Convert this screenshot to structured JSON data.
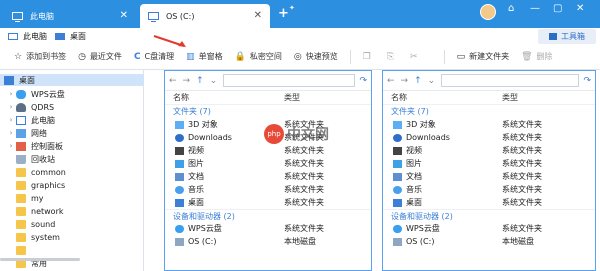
{
  "tabs": [
    {
      "label": "此电脑",
      "active": false
    },
    {
      "label": "OS (C:)",
      "active": true
    }
  ],
  "window_controls": {
    "minimize": "—",
    "restore": "▢",
    "close": "✕"
  },
  "quick_access": [
    {
      "label": "此电脑",
      "icon": "pc-icon"
    },
    {
      "label": "桌面",
      "icon": "desktop-icon"
    }
  ],
  "toolbox_label": "工具箱",
  "commands": [
    {
      "label": "添加到书签",
      "icon": "☆"
    },
    {
      "label": "最近文件",
      "icon": "◷"
    },
    {
      "label": "C盘清理",
      "icon": "C"
    },
    {
      "label": "单窗格",
      "icon": "▥"
    },
    {
      "label": "私密空间",
      "icon": "🔒"
    },
    {
      "label": "快速预览",
      "icon": "◎"
    }
  ],
  "edit_tools": {
    "copy": "❐",
    "paste": "⎘",
    "cut": "✂"
  },
  "right_commands": [
    {
      "label": "新建文件夹",
      "icon": "▭"
    },
    {
      "label": "删除",
      "icon": "🗑"
    }
  ],
  "sidebar": [
    {
      "label": "桌面",
      "icon": "desktop",
      "chev": "",
      "selected": true,
      "level": 0
    },
    {
      "label": "WPS云盘",
      "icon": "cloud",
      "chev": "›",
      "level": 1
    },
    {
      "label": "QDRS",
      "icon": "person",
      "chev": "›",
      "level": 1
    },
    {
      "label": "此电脑",
      "icon": "pc",
      "chev": "›",
      "level": 1
    },
    {
      "label": "网络",
      "icon": "net",
      "chev": "›",
      "level": 1
    },
    {
      "label": "控制面板",
      "icon": "ctrl",
      "chev": "›",
      "level": 1
    },
    {
      "label": "回收站",
      "icon": "bin",
      "chev": "",
      "level": 1
    },
    {
      "label": "common",
      "icon": "folder",
      "chev": "",
      "level": 1
    },
    {
      "label": "graphics",
      "icon": "folder",
      "chev": "",
      "level": 1
    },
    {
      "label": "my",
      "icon": "folder",
      "chev": "",
      "level": 1
    },
    {
      "label": "network",
      "icon": "folder",
      "chev": "",
      "level": 1
    },
    {
      "label": "sound",
      "icon": "folder",
      "chev": "",
      "level": 1
    },
    {
      "label": "system",
      "icon": "folder",
      "chev": "",
      "level": 1
    },
    {
      "label": "",
      "icon": "folder",
      "chev": "",
      "level": 1
    },
    {
      "label": "常用",
      "icon": "folder",
      "chev": "",
      "level": 1
    }
  ],
  "panes": {
    "columns": {
      "name": "名称",
      "type": "类型"
    },
    "group_folders": "文件夹 (7)",
    "group_drives": "设备和驱动器 (2)",
    "folders": [
      {
        "name": "3D 对象",
        "type": "系统文件夹",
        "icon": "i3d"
      },
      {
        "name": "Downloads",
        "type": "系统文件夹",
        "icon": "idl"
      },
      {
        "name": "视频",
        "type": "系统文件夹",
        "icon": "ivid"
      },
      {
        "name": "图片",
        "type": "系统文件夹",
        "icon": "ipic"
      },
      {
        "name": "文档",
        "type": "系统文件夹",
        "icon": "idoc"
      },
      {
        "name": "音乐",
        "type": "系统文件夹",
        "icon": "imus"
      },
      {
        "name": "桌面",
        "type": "系统文件夹",
        "icon": "idesk"
      }
    ],
    "drives": [
      {
        "name": "WPS云盘",
        "type": "系统文件夹",
        "icon": "icloud"
      },
      {
        "name": "OS (C:)",
        "type": "本地磁盘",
        "icon": "idisk"
      }
    ]
  },
  "watermark": {
    "logo": "php",
    "text": "中文网"
  }
}
